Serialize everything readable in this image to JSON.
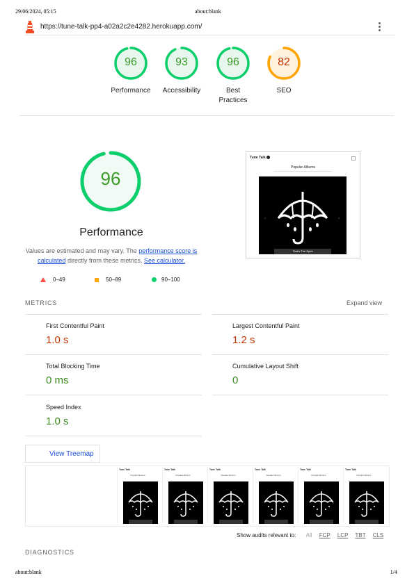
{
  "print_header": {
    "datetime": "29/06/2024, 05:15",
    "title": "about:blank"
  },
  "print_footer": {
    "left": "about:blank",
    "right": "1/4"
  },
  "url_bar": {
    "url": "https://tune-talk-pp4-a02a2c2e4282.herokuapp.com/"
  },
  "summary_gauges": [
    {
      "score": "96",
      "label_line1": "Performance",
      "label_line2": "",
      "value": 0.96,
      "color": "#0cce6b"
    },
    {
      "score": "93",
      "label_line1": "Accessibility",
      "label_line2": "",
      "value": 0.93,
      "color": "#0cce6b"
    },
    {
      "score": "96",
      "label_line1": "Best",
      "label_line2": "Practices",
      "value": 0.96,
      "color": "#0cce6b"
    },
    {
      "score": "82",
      "label_line1": "SEO",
      "label_line2": "",
      "value": 0.82,
      "color": "#ffa400"
    }
  ],
  "performance": {
    "score": "96",
    "value": 0.96,
    "title": "Performance",
    "desc_prefix": "Values are estimated and may vary. The ",
    "desc_link1": "performance score is calculated",
    "desc_mid": " directly from these metrics. ",
    "desc_link2": "See calculator.",
    "legend": {
      "fail": "0–49",
      "average": "50–89",
      "pass": "90–100"
    }
  },
  "screenshot_preview": {
    "brand": "Tune Talk",
    "heading": "Popular Albums",
    "caption": "That's The Spirit"
  },
  "metrics": {
    "section_title": "METRICS",
    "expand_label": "Expand view",
    "items": [
      {
        "label": "First Contentful Paint",
        "value": "1.0 s",
        "status": "average"
      },
      {
        "label": "Largest Contentful Paint",
        "value": "1.2 s",
        "status": "average"
      },
      {
        "label": "Total Blocking Time",
        "value": "0 ms",
        "status": "pass"
      },
      {
        "label": "Cumulative Layout Shift",
        "value": "0",
        "status": "pass"
      },
      {
        "label": "Speed Index",
        "value": "1.0 s",
        "status": "pass"
      }
    ]
  },
  "treemap_button": "View Treemap",
  "filmstrip": {
    "brand": "Tune Talk",
    "heading": "Popular Albums",
    "count": 6
  },
  "audit_filter": {
    "label": "Show audits relevant to:",
    "options": [
      "All",
      "FCP",
      "LCP",
      "TBT",
      "CLS"
    ]
  },
  "diagnostics_title": "DIAGNOSTICS",
  "colors": {
    "pass": "#0cce6b",
    "average": "#ffa400",
    "fail": "#ff4e42",
    "link": "#1a4fd6"
  }
}
